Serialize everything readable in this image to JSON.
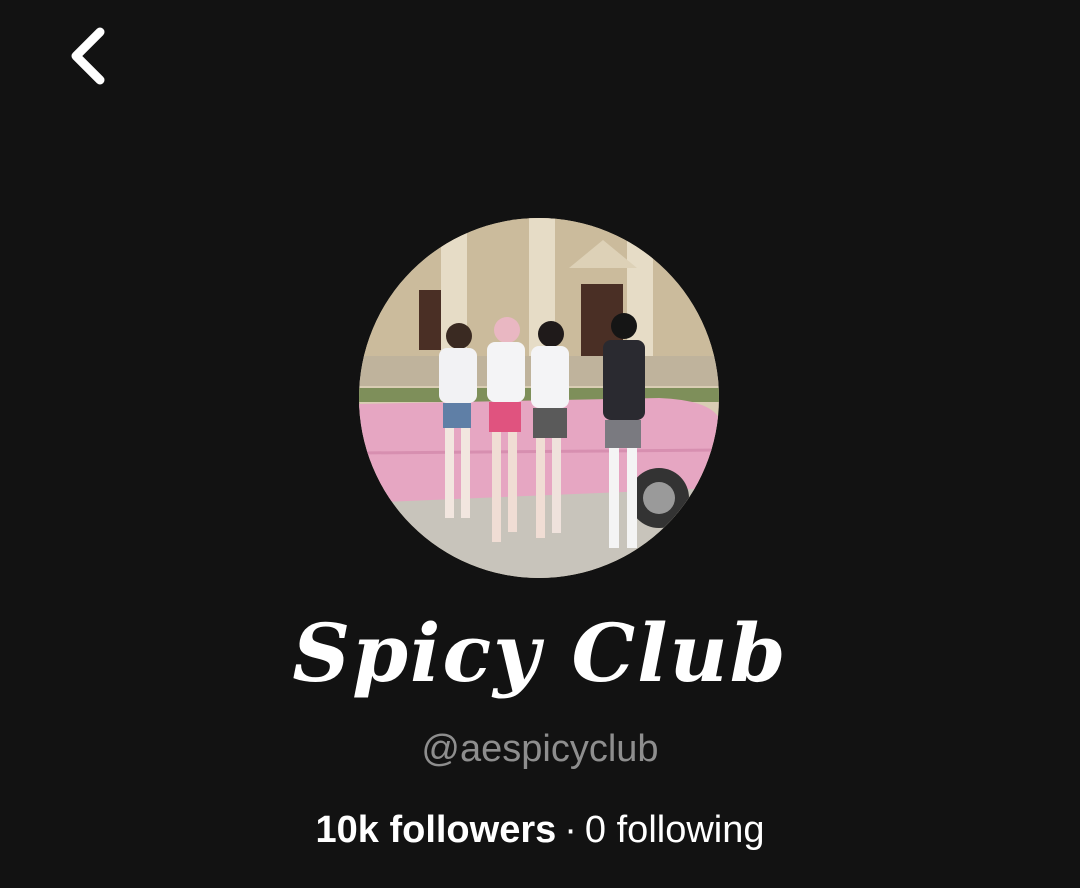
{
  "header": {
    "back_icon": "chevron-left-icon"
  },
  "profile": {
    "avatar_description": "group-photo",
    "display_name": "Spicy Club",
    "handle": "@aespicyclub",
    "followers_count": "10k",
    "followers_label": "followers",
    "separator": "·",
    "following_count": "0",
    "following_label": "following"
  },
  "colors": {
    "background": "#121212",
    "text_primary": "#ffffff",
    "text_secondary": "#8e8e8e"
  }
}
